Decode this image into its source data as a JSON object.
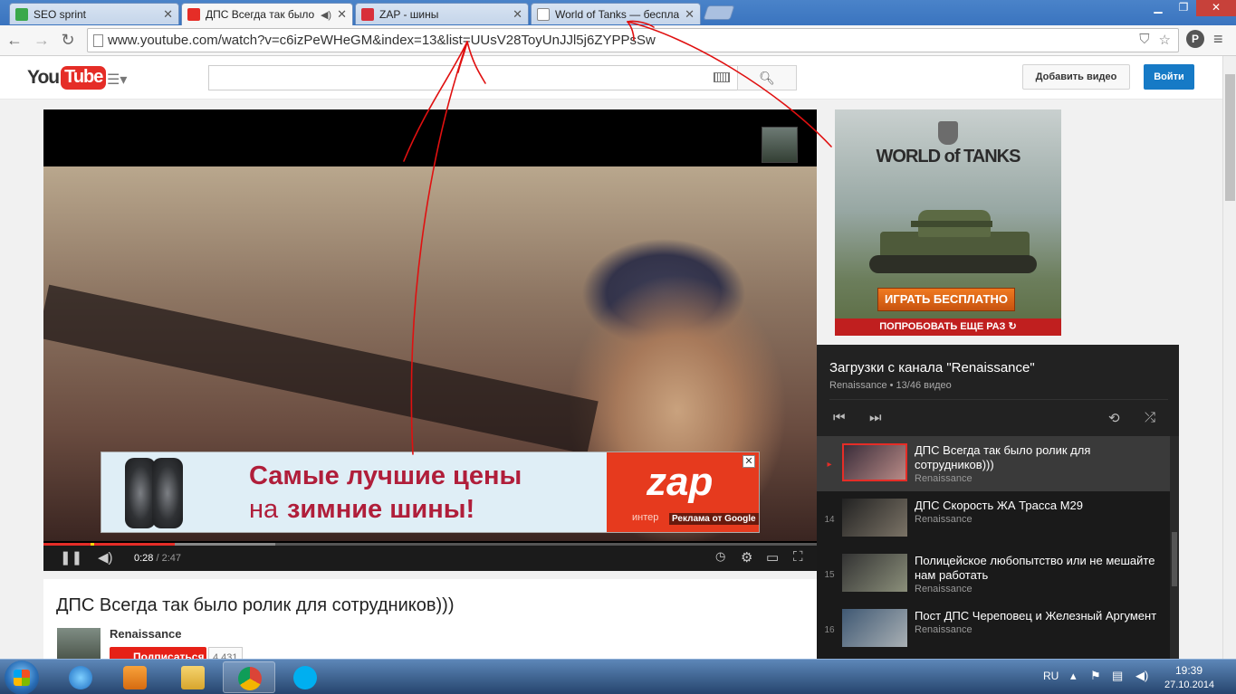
{
  "browser": {
    "tabs": [
      {
        "title": "SEO sprint",
        "active": false
      },
      {
        "title": "ДПС Всегда так было",
        "active": true
      },
      {
        "title": "ZAP - шины",
        "active": false
      },
      {
        "title": "World of Tanks — беспла",
        "active": false
      }
    ],
    "url": "www.youtube.com/watch?v=c6izPeWHeGM&index=13&list=UUsV28ToyUnJJl5j6ZYPPsSw",
    "profile_letter": "P"
  },
  "youtube": {
    "logo_you": "You",
    "logo_tube": "Tube",
    "upload_label": "Добавить видео",
    "signin_label": "Войти"
  },
  "ad_banner": {
    "line1": "Самые лучшие цены",
    "line2_prefix": "на",
    "line2_bold": "зимние шины!",
    "brand": "zap",
    "brand_sub": "интер",
    "google_label": "Реклама от Google",
    "close": "✕"
  },
  "player": {
    "current_time": "0:28",
    "duration": "/ 2:47",
    "progress_played": 0.17,
    "progress_buffered": 0.3
  },
  "video": {
    "title": "ДПС Всегда так было ролик для сотрудников)))",
    "owner": "Renaissance",
    "subscribe_label": "Подписаться",
    "subscriber_count": "4 431"
  },
  "side_ad": {
    "title": "WORLD of TANKS",
    "play_label": "ИГРАТЬ БЕСПЛАТНО",
    "retry_label": "ПОПРОБОВАТЬ ЕЩЕ РАЗ ↻"
  },
  "playlist": {
    "title": "Загрузки с канала \"Renaissance\"",
    "subtitle": "Renaissance • 13/46 видео",
    "items": [
      {
        "index": "▸",
        "title": "ДПС Всегда так было ролик для сотрудников)))",
        "owner": "Renaissance",
        "active": true
      },
      {
        "index": "14",
        "title": "ДПС Скорость ЖА Трасса М29",
        "owner": "Renaissance",
        "active": false
      },
      {
        "index": "15",
        "title": "Полицейское любопытство или не мешайте нам работать",
        "owner": "Renaissance",
        "active": false
      },
      {
        "index": "16",
        "title": "Пост ДПС Череповец и Железный Аргумент",
        "owner": "Renaissance",
        "active": false
      }
    ]
  },
  "taskbar": {
    "language": "RU",
    "time": "19:39",
    "date": "27.10.2014"
  },
  "colors": {
    "youtube_red": "#e52d27",
    "signin_blue": "#167ac6",
    "annotation_red": "#e01010"
  }
}
